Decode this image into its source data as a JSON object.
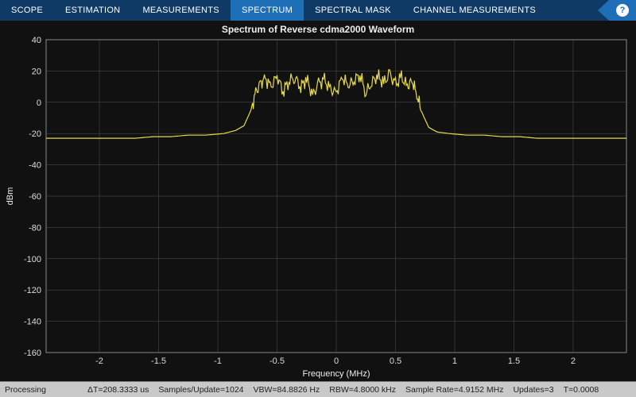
{
  "tabs": {
    "scope": "SCOPE",
    "estimation": "ESTIMATION",
    "measurements": "MEASUREMENTS",
    "spectrum": "SPECTRUM",
    "spectral_mask": "SPECTRAL MASK",
    "channel_meas": "CHANNEL MEASUREMENTS"
  },
  "help_glyph": "?",
  "chart_title": "Spectrum of Reverse cdma2000 Waveform",
  "axes": {
    "xlabel": "Frequency (MHz)",
    "ylabel": "dBm",
    "yticks": [
      "40",
      "20",
      "0",
      "-20",
      "-40",
      "-60",
      "-80",
      "-100",
      "-120",
      "-140",
      "-160"
    ],
    "xticks": [
      "-2",
      "-1.5",
      "-1",
      "-0.5",
      "0",
      "0.5",
      "1",
      "1.5",
      "2"
    ]
  },
  "status": {
    "processing": "Processing",
    "dt": "ΔT=208.3333 us",
    "samples": "Samples/Update=1024",
    "vbw": "VBW=84.8826 Hz",
    "rbw": "RBW=4.8000 kHz",
    "sample_rate": "Sample Rate=4.9152 MHz",
    "updates": "Updates=3",
    "t": "T=0.0008"
  },
  "chart_data": {
    "type": "line",
    "title": "Spectrum of Reverse cdma2000 Waveform",
    "xlabel": "Frequency (MHz)",
    "ylabel": "dBm",
    "xlim": [
      -2.45,
      2.45
    ],
    "ylim": [
      -160,
      40
    ],
    "series": [
      {
        "name": "Spectrum",
        "color": "#e6d94a",
        "x": [
          -2.45,
          -2.3,
          -2.15,
          -2.0,
          -1.85,
          -1.7,
          -1.55,
          -1.4,
          -1.25,
          -1.1,
          -0.95,
          -0.85,
          -0.78,
          -0.72,
          -0.68,
          -0.64,
          -0.6,
          -0.55,
          -0.5,
          -0.45,
          -0.4,
          -0.35,
          -0.3,
          -0.25,
          -0.2,
          -0.15,
          -0.1,
          -0.05,
          0.0,
          0.05,
          0.1,
          0.15,
          0.2,
          0.25,
          0.3,
          0.35,
          0.4,
          0.45,
          0.5,
          0.55,
          0.6,
          0.64,
          0.68,
          0.72,
          0.78,
          0.85,
          0.95,
          1.1,
          1.25,
          1.4,
          1.55,
          1.7,
          1.85,
          2.0,
          2.15,
          2.3,
          2.45
        ],
        "y": [
          -23,
          -23,
          -23,
          -23,
          -23,
          -23,
          -22,
          -22,
          -21,
          -21,
          -20,
          -18,
          -15,
          -5,
          6,
          12,
          15,
          10,
          17,
          7,
          14,
          16,
          10,
          15,
          4,
          12,
          14,
          8,
          6,
          16,
          11,
          14,
          18,
          6,
          13,
          17,
          12,
          18,
          11,
          16,
          10,
          14,
          5,
          -6,
          -16,
          -19,
          -20,
          -21,
          -21,
          -22,
          -22,
          -23,
          -23,
          -23,
          -23,
          -23,
          -23
        ]
      }
    ]
  }
}
